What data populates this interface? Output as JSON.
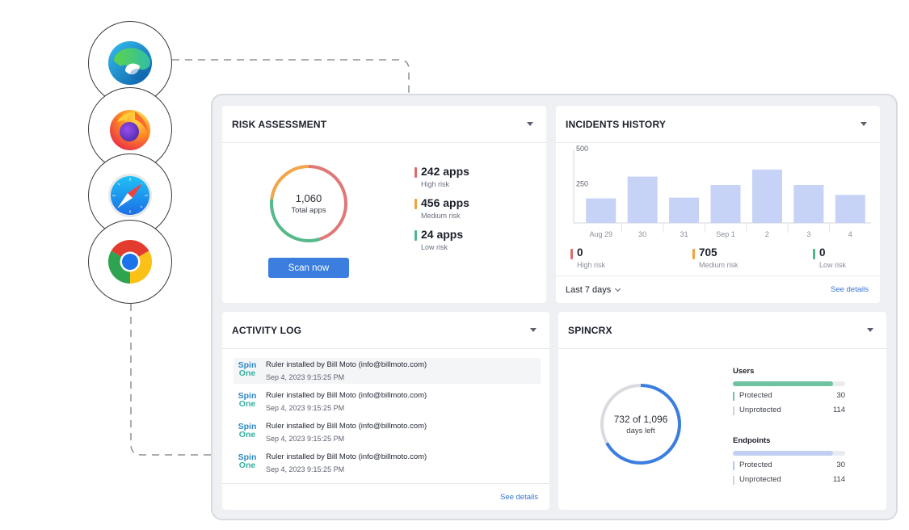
{
  "browsers": [
    {
      "name": "Microsoft Edge",
      "icon": "edge-icon"
    },
    {
      "name": "Firefox",
      "icon": "firefox-icon"
    },
    {
      "name": "Safari",
      "icon": "safari-icon"
    },
    {
      "name": "Chrome",
      "icon": "chrome-icon"
    }
  ],
  "risk": {
    "title": "RISK ASSESSMENT",
    "total_value": "1,060",
    "total_label": "Total apps",
    "scan_label": "Scan now",
    "stats": [
      {
        "value": "242 apps",
        "label": "High risk",
        "color": "#e06b6b"
      },
      {
        "value": "456 apps",
        "label": "Medium risk",
        "color": "#f2a23c"
      },
      {
        "value": "24 apps",
        "label": "Low risk",
        "color": "#4fb58a"
      }
    ]
  },
  "incidents": {
    "title": "INCIDENTS HISTORY",
    "period": "Last 7 days",
    "see_details": "See details",
    "stats": [
      {
        "value": "0",
        "label": "High risk",
        "color": "#e06b6b"
      },
      {
        "value": "705",
        "label": "Medium risk",
        "color": "#f2a23c"
      },
      {
        "value": "0",
        "label": "Low risk",
        "color": "#4fb58a"
      }
    ]
  },
  "activity": {
    "title": "ACTIVITY LOG",
    "see_details": "See details",
    "logo_top": "Spin",
    "logo_bottom": "One",
    "rows": [
      {
        "text": "Ruler installed by Bill Moto (info@billmoto.com)",
        "time": "Sep 4, 2023 9:15:25 PM"
      },
      {
        "text": "Ruler installed by Bill Moto (info@billmoto.com)",
        "time": "Sep 4, 2023 9:15:25 PM"
      },
      {
        "text": "Ruler installed by Bill Moto (info@billmoto.com)",
        "time": "Sep 4, 2023 9:15:25 PM"
      },
      {
        "text": "Ruler installed by Bill Moto (info@billmoto.com)",
        "time": "Sep 4, 2023 9:15:25 PM"
      }
    ]
  },
  "spin": {
    "title": "SPINCRX",
    "days_value": "732 of 1,096",
    "days_label": "days left",
    "days_fraction": 0.668,
    "users": {
      "title": "Users",
      "fill_fraction": 0.89,
      "color": "#6fc3a0",
      "rows": [
        {
          "name": "Protected",
          "value": "30",
          "color": "#6fc3a0"
        },
        {
          "name": "Unprotected",
          "value": "114",
          "color": "#d0d3da"
        }
      ]
    },
    "endpoints": {
      "title": "Endpoints",
      "fill_fraction": 0.89,
      "color": "#c3cff2",
      "rows": [
        {
          "name": "Protected",
          "value": "30",
          "color": "#b7c6f0"
        },
        {
          "name": "Unprotected",
          "value": "114",
          "color": "#d0d3da"
        }
      ]
    }
  },
  "chart_data": {
    "type": "bar",
    "categories": [
      "Aug 29",
      "30",
      "31",
      "Sep 1",
      "2",
      "3",
      "4"
    ],
    "values": [
      175,
      330,
      180,
      270,
      380,
      270,
      200
    ],
    "yticks": [
      "500",
      "250"
    ],
    "ylim": [
      0,
      500
    ],
    "bar_color": "#c6d3f6"
  }
}
